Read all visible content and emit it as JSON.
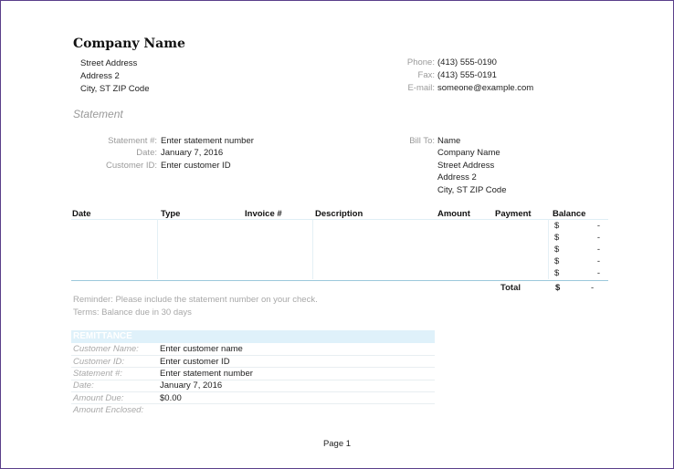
{
  "company": {
    "name": "Company Name",
    "street": "Street Address",
    "address2": "Address 2",
    "city": "City, ST  ZIP Code"
  },
  "contact": {
    "phone_label": "Phone:",
    "phone": "(413) 555-0190",
    "fax_label": "Fax:",
    "fax": "(413) 555-0191",
    "email_label": "E-mail:",
    "email": "someone@example.com"
  },
  "title": "Statement",
  "statement_info": {
    "number_label": "Statement #:",
    "number": "Enter statement number",
    "date_label": "Date:",
    "date": "January 7, 2016",
    "customer_label": "Customer ID:",
    "customer": "Enter customer ID"
  },
  "bill_to": {
    "label": "Bill To:",
    "name": "Name",
    "company": "Company Name",
    "street": "Street Address",
    "address2": "Address 2",
    "city": "City, ST  ZIP Code"
  },
  "table": {
    "headers": [
      "Date",
      "Type",
      "Invoice #",
      "Description",
      "Amount",
      "Payment",
      "Balance"
    ],
    "balance_rows": [
      {
        "currency": "$",
        "value": "-"
      },
      {
        "currency": "$",
        "value": "-"
      },
      {
        "currency": "$",
        "value": "-"
      },
      {
        "currency": "$",
        "value": "-"
      },
      {
        "currency": "$",
        "value": "-"
      }
    ],
    "total_label": "Total",
    "total_currency": "$",
    "total_value": "-"
  },
  "notes": {
    "reminder": "Reminder: Please include the statement number on your check.",
    "terms": "Terms: Balance due in 30 days"
  },
  "remittance": {
    "heading": "REMITTANCE",
    "rows": [
      {
        "label": "Customer Name:",
        "value": "Enter customer name"
      },
      {
        "label": "Customer ID:",
        "value": "Enter customer ID"
      },
      {
        "label": "Statement #:",
        "value": "Enter statement number"
      },
      {
        "label": "Date:",
        "value": "January 7, 2016"
      },
      {
        "label": "Amount Due:",
        "value": "$0.00"
      },
      {
        "label": "Amount Enclosed:",
        "value": ""
      }
    ]
  },
  "footer": {
    "page": "Page 1"
  }
}
